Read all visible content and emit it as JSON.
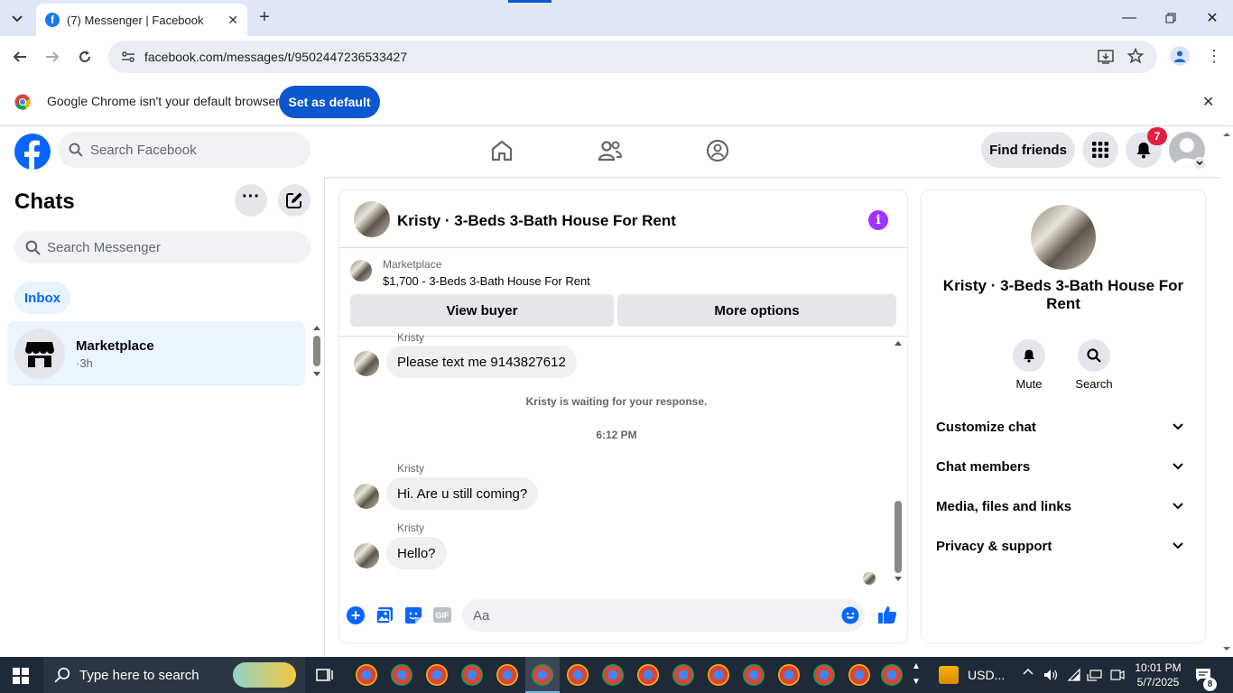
{
  "browser": {
    "tab_title": "(7) Messenger | Facebook",
    "url": "facebook.com/messages/t/9502447236533427",
    "infobar_text": "Google Chrome isn't your default browser",
    "set_default_label": "Set as default"
  },
  "facebook": {
    "search_placeholder": "Search Facebook",
    "find_friends_label": "Find friends",
    "notification_count": "7"
  },
  "sidebar": {
    "title": "Chats",
    "search_placeholder": "Search Messenger",
    "filter_label": "Inbox",
    "chats": [
      {
        "name": "Marketplace",
        "time": "·3h"
      }
    ]
  },
  "conversation": {
    "title": "Kristy · 3-Beds 3-Bath House For Rent",
    "marketplace_label": "Marketplace",
    "listing": "$1,700 - 3-Beds 3-Bath House For Rent",
    "view_buyer_label": "View buyer",
    "more_options_label": "More options",
    "messages": [
      {
        "sender": "Kristy",
        "text": "Please text me 9143827612"
      },
      {
        "system": "Kristy is waiting for your response."
      },
      {
        "timestamp": "6:12 PM"
      },
      {
        "sender": "Kristy",
        "text": "Hi. Are u still coming?"
      },
      {
        "sender": "Kristy",
        "text": "Hello?"
      }
    ],
    "composer_placeholder": "Aa"
  },
  "info_panel": {
    "name": "Kristy · 3-Beds 3-Bath House For Rent",
    "actions": [
      {
        "label": "Mute",
        "icon": "bell-icon"
      },
      {
        "label": "Search",
        "icon": "search-icon"
      }
    ],
    "sections": [
      "Customize chat",
      "Chat members",
      "Media, files and links",
      "Privacy & support"
    ]
  },
  "taskbar": {
    "search_placeholder": "Type here to search",
    "currency": "USD...",
    "time": "10:01 PM",
    "date": "5/7/2025",
    "notification_count": "8"
  },
  "colors": {
    "facebook_blue": "#0866ff",
    "chrome_blue": "#0b57d0",
    "messenger_purple": "#a033ff"
  }
}
